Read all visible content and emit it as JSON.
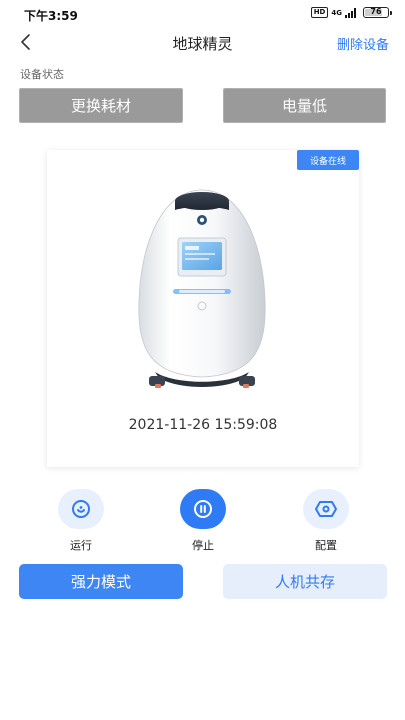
{
  "status_bar": {
    "time": "下午3:59",
    "hd": "HD",
    "network": "4G",
    "battery_percent": "76",
    "battery_level": 0.76
  },
  "header": {
    "back_icon": "chevron-left-icon",
    "title": "地球精灵",
    "delete_label": "删除设备"
  },
  "device_status": {
    "label": "设备状态",
    "buttons": [
      "更换耗材",
      "电量低"
    ],
    "button_color": "#9a9a9a"
  },
  "device_card": {
    "online_badge": "设备在线",
    "image": "robot-purifier-image",
    "timestamp": "2021-11-26 15:59:08"
  },
  "controls": [
    {
      "label": "运行",
      "icon": "target-icon",
      "active": false
    },
    {
      "label": "停止",
      "icon": "pause-icon",
      "active": true
    },
    {
      "label": "配置",
      "icon": "hexagon-config-icon",
      "active": false
    }
  ],
  "modes": {
    "strong": "强力模式",
    "coexist": "人机共存"
  },
  "colors": {
    "accent": "#2f7bf5",
    "accent_light": "#e6eefc",
    "disabled_gray": "#9a9a9a"
  }
}
